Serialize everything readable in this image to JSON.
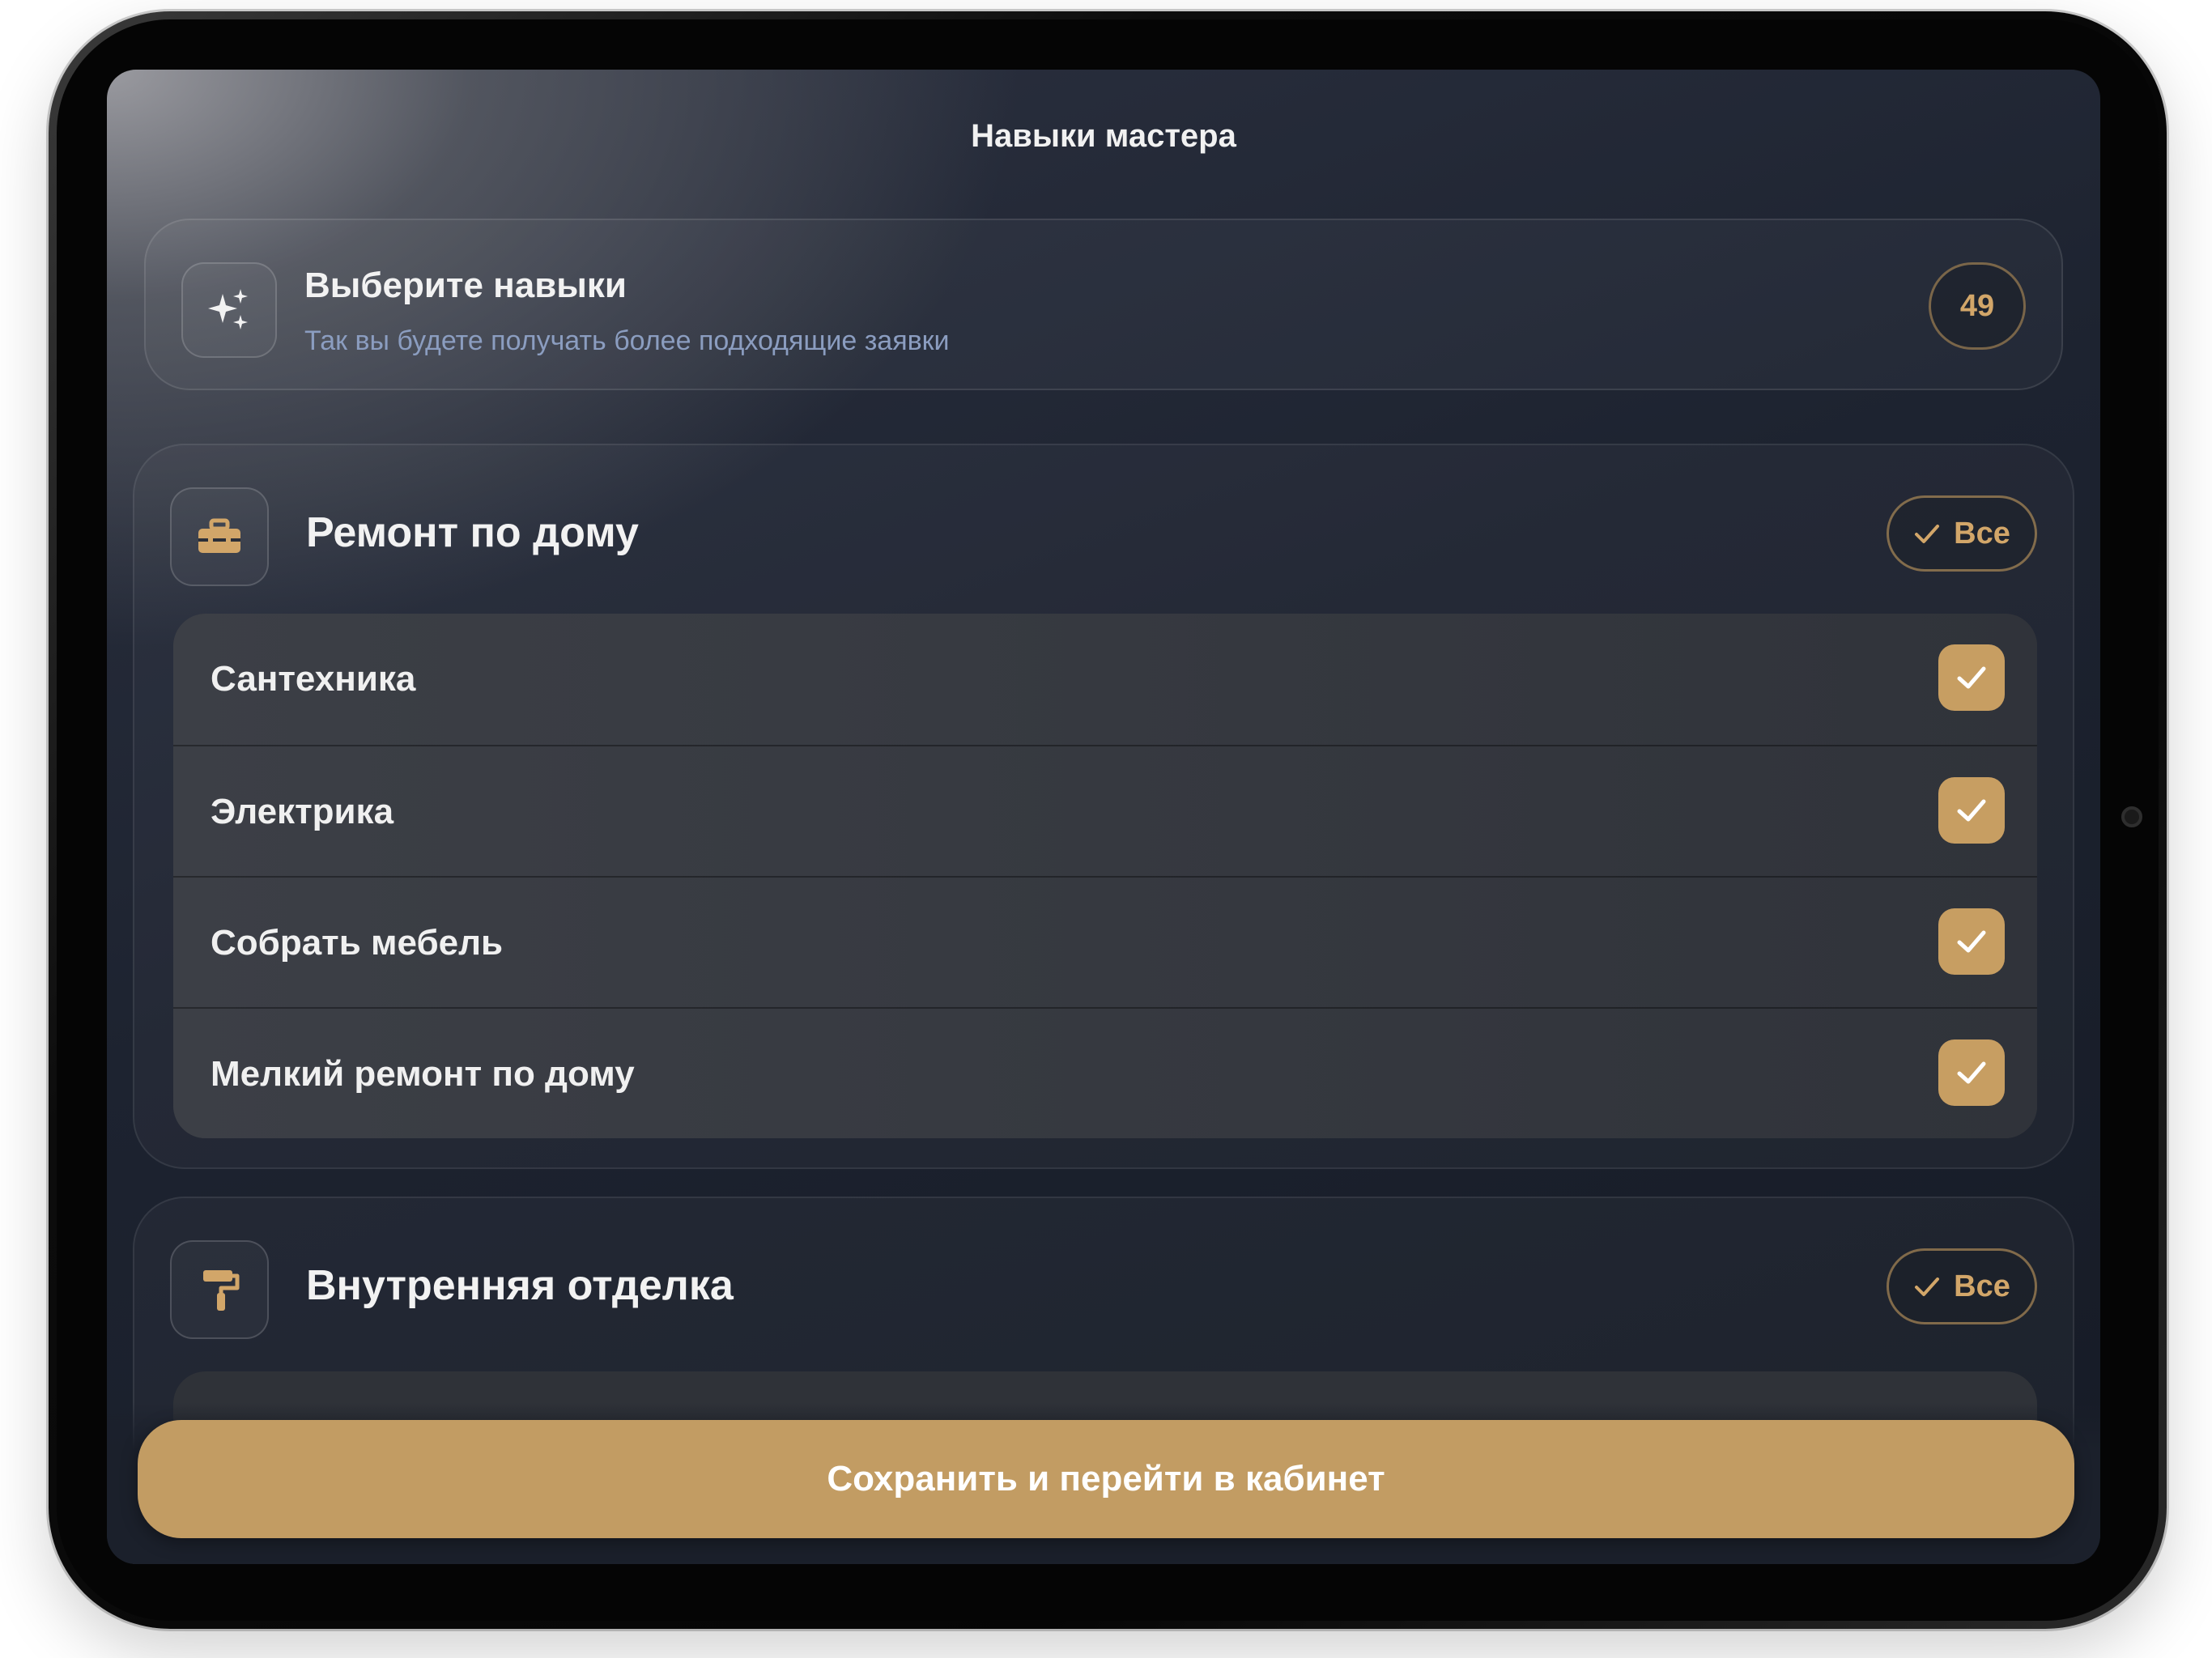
{
  "app": {
    "title": "Навыки мастера"
  },
  "intro": {
    "title": "Выберите навыки",
    "subtitle": "Так вы будете получать более подходящие заявки",
    "count": "49",
    "icon": "sparkles-icon"
  },
  "categories": [
    {
      "title": "Ремонт по дому",
      "icon": "toolbox-icon",
      "select_all_label": "Все",
      "items": [
        {
          "label": "Сантехника",
          "checked": true
        },
        {
          "label": "Электрика",
          "checked": true
        },
        {
          "label": "Собрать мебель",
          "checked": true
        },
        {
          "label": "Мелкий ремонт по дому",
          "checked": true
        }
      ]
    },
    {
      "title": "Внутренняя отделка",
      "icon": "paint-roller-icon",
      "select_all_label": "Все",
      "items": []
    }
  ],
  "footer": {
    "save_label": "Сохранить и перейти в кабинет"
  },
  "colors": {
    "accent": "#c79e62",
    "accent_text": "#d2a669",
    "background": "#1d2330",
    "subtitle": "#8b9dc0"
  }
}
